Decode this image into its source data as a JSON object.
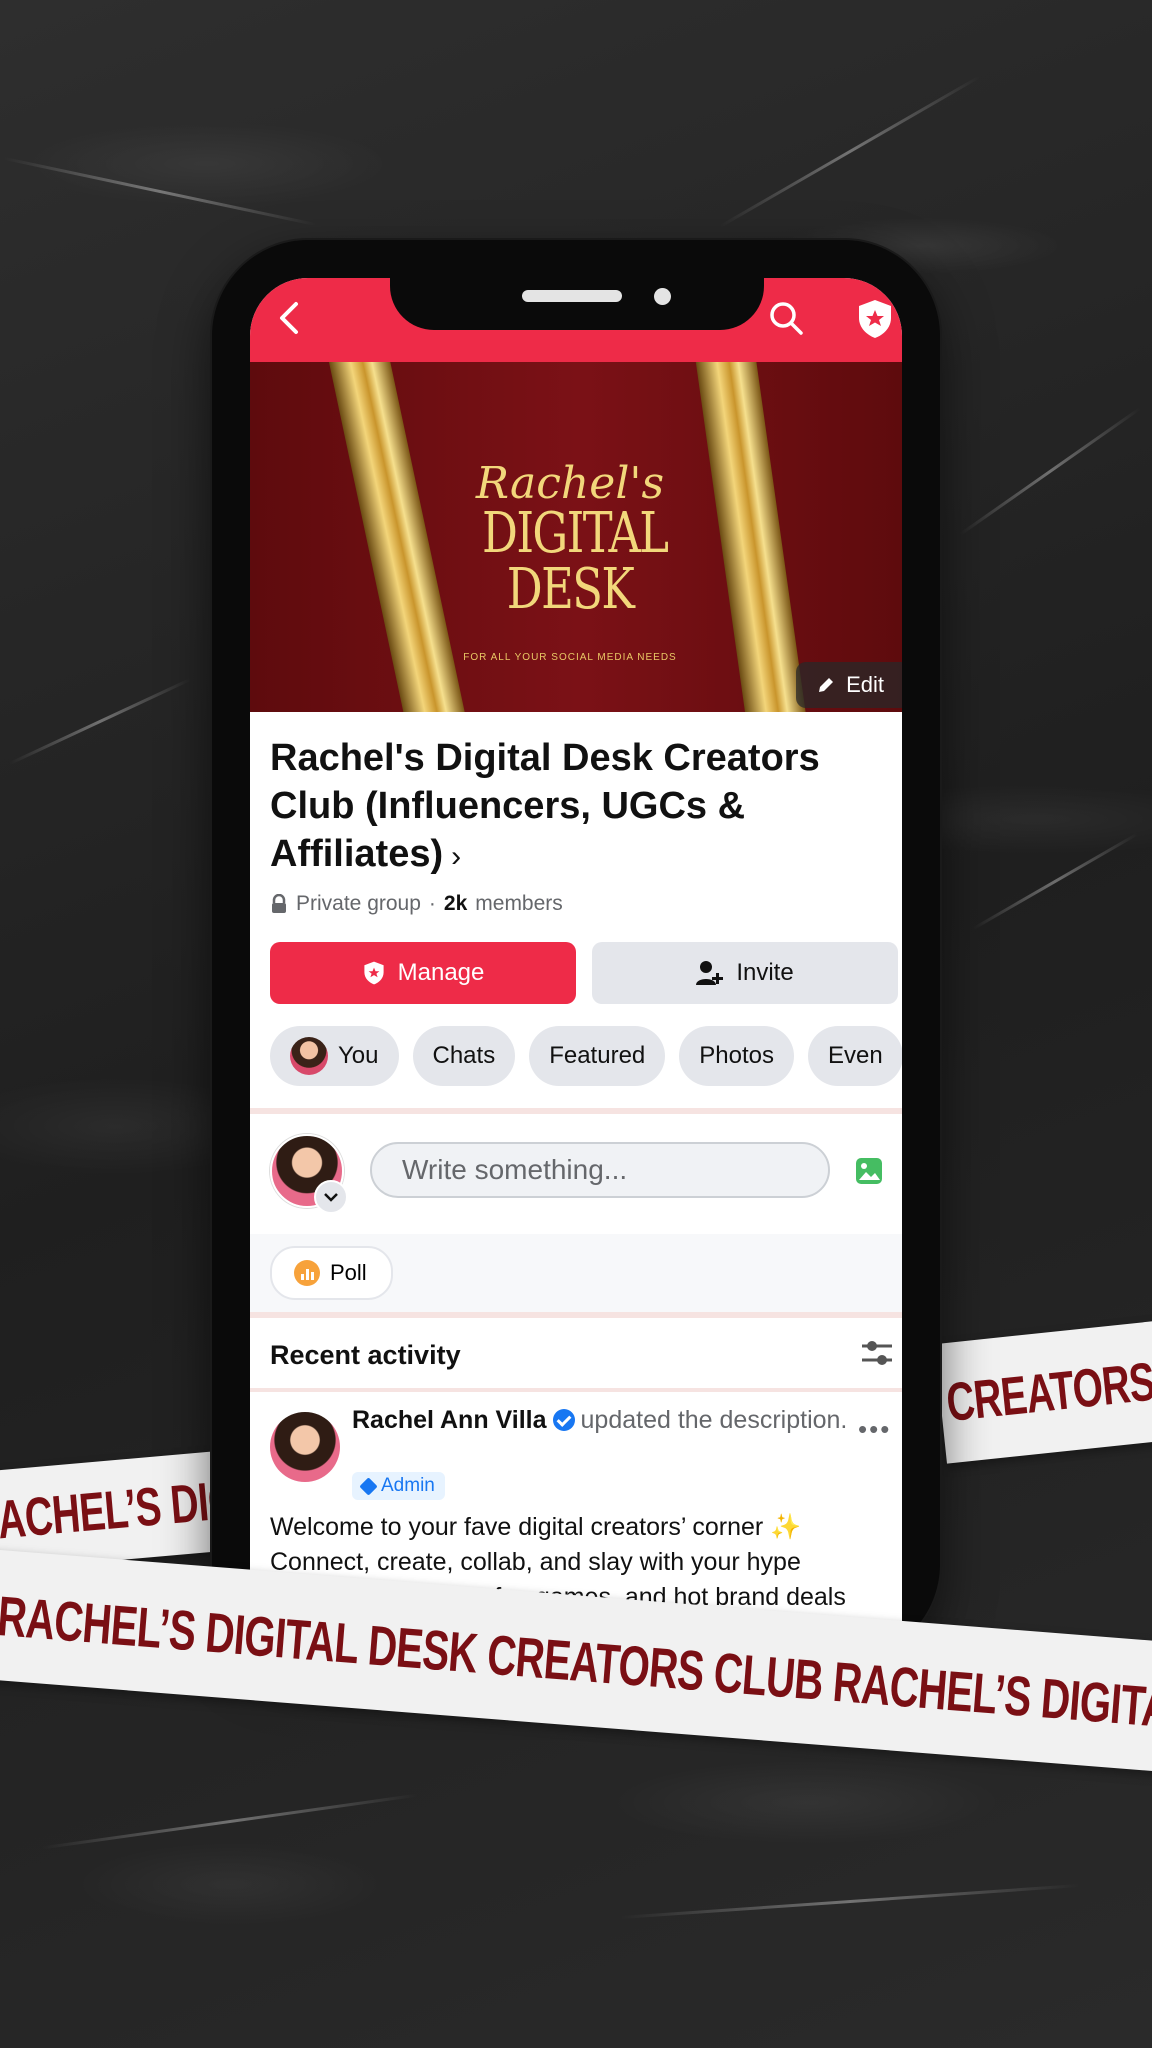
{
  "header": {
    "back_icon": "chevron-left-icon",
    "search_icon": "search-icon",
    "shield_icon": "admin-shield-icon"
  },
  "cover": {
    "script_title": "Rachel's",
    "title_line1": "DIGITAL",
    "title_line2": "DESK",
    "tagline": "FOR ALL YOUR SOCIAL MEDIA NEEDS",
    "edit_label": "Edit"
  },
  "group": {
    "name": "Rachel's Digital Desk Creators Club (Influencers, UGCs & Affiliates)",
    "privacy": "Private group",
    "separator": " · ",
    "member_count": "2k",
    "members_label": "members"
  },
  "actions": {
    "manage_label": "Manage",
    "invite_label": "Invite"
  },
  "tabs": [
    {
      "label": "You"
    },
    {
      "label": "Chats"
    },
    {
      "label": "Featured"
    },
    {
      "label": "Photos"
    },
    {
      "label": "Even"
    }
  ],
  "composer": {
    "placeholder": "Write something...",
    "poll_label": "Poll"
  },
  "activity": {
    "heading": "Recent activity",
    "post": {
      "author": "Rachel Ann Villa",
      "action": "updated the description.",
      "role": "Admin",
      "body_line1": "Welcome to your fave digital creators’ corner ✨",
      "body_line2": "Connect, create, collab, and slay with your hype",
      "body_line3": "squad. Poppin’ tips, fun games, and hot brand deals"
    }
  },
  "tapes": {
    "main": "RACHEL’S DIGITAL DESK CREATORS CLUB  RACHEL’S DIGITAL DESK CREATORS CLUB",
    "left": "RACHEL’S DIGITAL",
    "right": "CREATORS CLUB"
  },
  "colors": {
    "brand": "#ee2b48",
    "tape_text": "#7a0f14"
  }
}
